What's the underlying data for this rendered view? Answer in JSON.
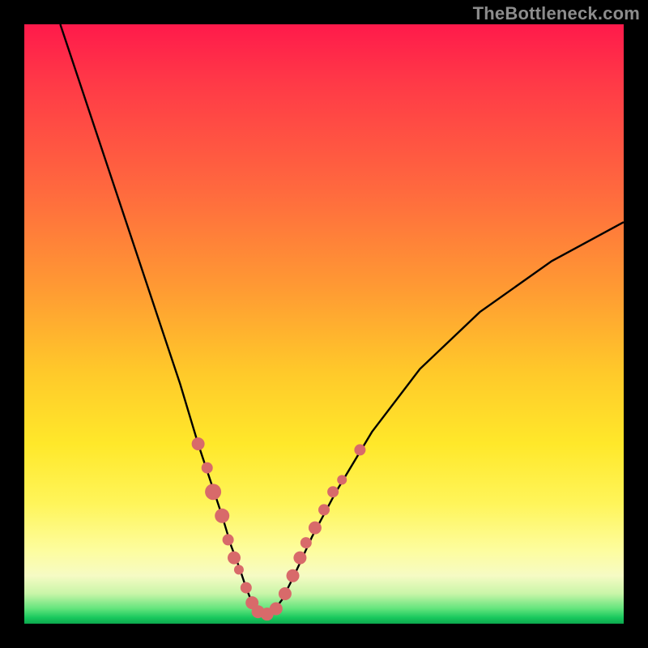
{
  "watermark": "TheBottleneck.com",
  "chart_data": {
    "type": "line",
    "title": "",
    "xlabel": "",
    "ylabel": "",
    "xlim": [
      0,
      100
    ],
    "ylim": [
      0,
      100
    ],
    "series": [
      {
        "name": "bottleneck-curve",
        "x": [
          6,
          10,
          14,
          18,
          22,
          26,
          29,
          31,
          33,
          34.5,
          36,
          37,
          38,
          39,
          40,
          41.5,
          43,
          45,
          48,
          52,
          58,
          66,
          76,
          88,
          100
        ],
        "y": [
          100,
          88,
          76,
          64,
          52,
          40,
          30,
          24,
          18,
          13,
          9,
          6,
          3.5,
          2,
          1.5,
          2,
          4,
          8,
          14.5,
          22,
          32,
          42.5,
          52,
          60.5,
          67
        ]
      }
    ],
    "markers": {
      "name": "highlight-points",
      "color": "#d86a6a",
      "points": [
        {
          "x": 29,
          "y": 30,
          "r": 8
        },
        {
          "x": 30.5,
          "y": 26,
          "r": 7
        },
        {
          "x": 31.5,
          "y": 22,
          "r": 10
        },
        {
          "x": 33,
          "y": 18,
          "r": 9
        },
        {
          "x": 34,
          "y": 14,
          "r": 7
        },
        {
          "x": 35,
          "y": 11,
          "r": 8
        },
        {
          "x": 35.8,
          "y": 9,
          "r": 6
        },
        {
          "x": 37,
          "y": 6,
          "r": 7
        },
        {
          "x": 38,
          "y": 3.5,
          "r": 8
        },
        {
          "x": 39,
          "y": 2,
          "r": 8
        },
        {
          "x": 40.5,
          "y": 1.6,
          "r": 8
        },
        {
          "x": 42,
          "y": 2.5,
          "r": 8
        },
        {
          "x": 43.5,
          "y": 5,
          "r": 8
        },
        {
          "x": 44.8,
          "y": 8,
          "r": 8
        },
        {
          "x": 46,
          "y": 11,
          "r": 8
        },
        {
          "x": 47,
          "y": 13.5,
          "r": 7
        },
        {
          "x": 48.5,
          "y": 16,
          "r": 8
        },
        {
          "x": 50,
          "y": 19,
          "r": 7
        },
        {
          "x": 51.5,
          "y": 22,
          "r": 7
        },
        {
          "x": 53,
          "y": 24,
          "r": 6
        },
        {
          "x": 56,
          "y": 29,
          "r": 7
        }
      ]
    },
    "colors": {
      "curve": "#000000",
      "marker": "#d86a6a",
      "gradient_top": "#ff1a4b",
      "gradient_mid": "#ffe82a",
      "gradient_bottom": "#0da84e",
      "background": "#000000",
      "watermark": "#8c8c8c"
    }
  }
}
